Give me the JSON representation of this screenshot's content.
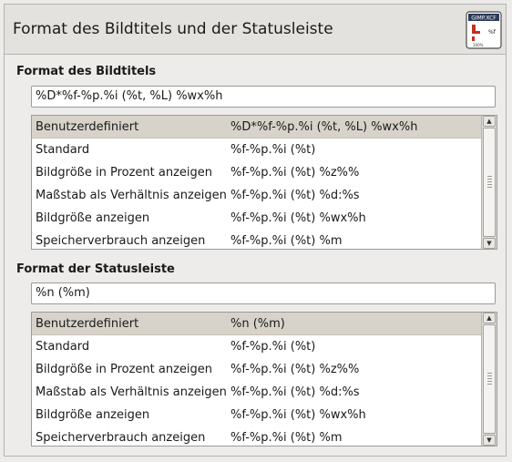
{
  "header": {
    "title": "Format des Bildtitels und der Statusleiste",
    "icon": "gimp-xcf-title-format-icon",
    "icon_text_top": "GIMP.XCF",
    "icon_text_side": "%f",
    "icon_text_bottom": "100%"
  },
  "image_title": {
    "label": "Format des Bildtitels",
    "value": "%D*%f-%p.%i (%t, %L) %wx%h",
    "presets": [
      {
        "name": "Benutzerdefiniert",
        "format": "%D*%f-%p.%i (%t, %L) %wx%h"
      },
      {
        "name": "Standard",
        "format": "%f-%p.%i (%t)"
      },
      {
        "name": "Bildgröße in Prozent anzeigen",
        "format": "%f-%p.%i (%t) %z%%"
      },
      {
        "name": "Maßstab als Verhältnis anzeigen",
        "format": "%f-%p.%i (%t) %d:%s"
      },
      {
        "name": "Bildgröße anzeigen",
        "format": "%f-%p.%i (%t) %wx%h"
      },
      {
        "name": "Speicherverbrauch anzeigen",
        "format": "%f-%p.%i (%t) %m"
      }
    ]
  },
  "status_bar": {
    "label": "Format der Statusleiste",
    "value": "%n (%m)",
    "presets": [
      {
        "name": "Benutzerdefiniert",
        "format": "%n (%m)"
      },
      {
        "name": "Standard",
        "format": "%f-%p.%i (%t)"
      },
      {
        "name": "Bildgröße in Prozent anzeigen",
        "format": "%f-%p.%i (%t) %z%%"
      },
      {
        "name": "Maßstab als Verhältnis anzeigen",
        "format": "%f-%p.%i (%t) %d:%s"
      },
      {
        "name": "Bildgröße anzeigen",
        "format": "%f-%p.%i (%t) %wx%h"
      },
      {
        "name": "Speicherverbrauch anzeigen",
        "format": "%f-%p.%i (%t) %m"
      }
    ]
  },
  "scroll": {
    "up_icon": "arrow-up-icon",
    "down_icon": "arrow-down-icon",
    "up_glyph": "▲",
    "down_glyph": "▼"
  },
  "colors": {
    "selection": "#d8d3ca",
    "background": "#edeceb",
    "border": "#9d9b96"
  }
}
